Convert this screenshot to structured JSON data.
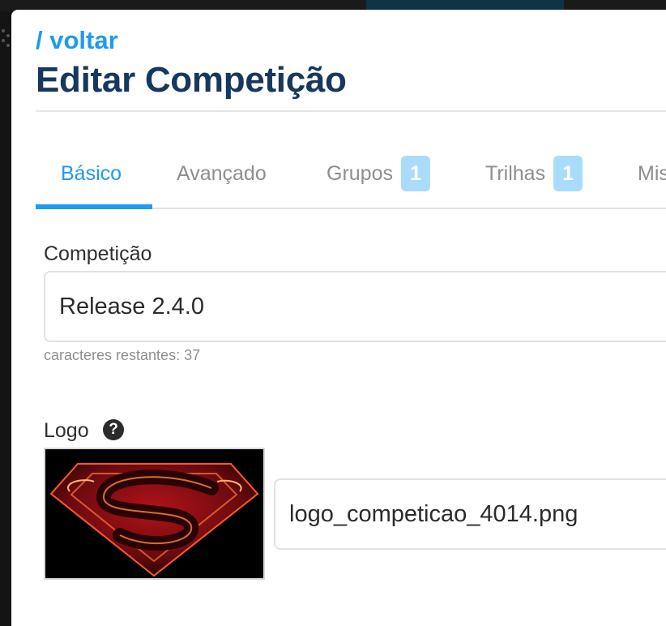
{
  "nav": {
    "back_label": "/ voltar"
  },
  "page": {
    "title": "Editar Competição"
  },
  "tabs": [
    {
      "label": "Básico",
      "active": true
    },
    {
      "label": "Avançado"
    },
    {
      "label": "Grupos",
      "badge": "1"
    },
    {
      "label": "Trilhas",
      "badge": "1"
    },
    {
      "label": "Mis"
    }
  ],
  "form": {
    "competition": {
      "label": "Competição",
      "value": "Release 2.4.0",
      "helper": "caracteres restantes: 37"
    },
    "logo": {
      "label": "Logo",
      "help_icon": "?",
      "filename": "logo_competicao_4014.png"
    }
  },
  "colors": {
    "accent": "#1e9bef",
    "title": "#17375e",
    "badge": "#a9dcfb",
    "muted": "#8e8e8e"
  }
}
